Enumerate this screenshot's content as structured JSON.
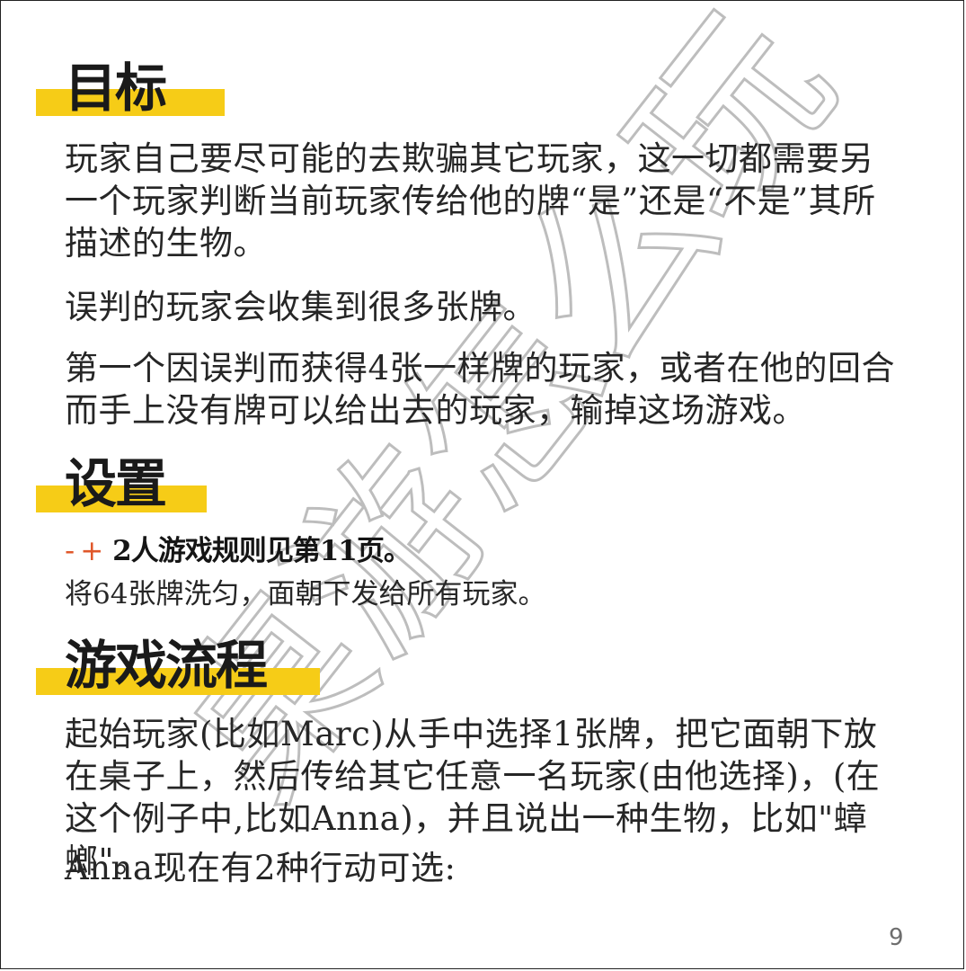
{
  "sections": {
    "goal": {
      "title": "目标",
      "paragraphs": [
        "玩家自己要尽可能的去欺骗其它玩家，这一切都需要另一个玩家判断当前玩家传给他的牌“是”还是“不是”其所描述的生物。",
        "误判的玩家会收集到很多张牌。",
        "第一个因误判而获得4张一样牌的玩家，或者在他的回合而手上没有牌可以给出去的玩家，输掉这场游戏。"
      ]
    },
    "setup": {
      "title": "设置",
      "dash": "-",
      "plus": "+",
      "rule_ref": "2人游戏规则见第11页。",
      "text": "将64张牌洗匀，面朝下发给所有玩家。"
    },
    "flow": {
      "title": "游戏流程",
      "paragraphs": [
        "起始玩家(比如Marc)从手中选择1张牌，把它面朝下放在桌子上，然后传给其它任意一名玩家(由他选择)，(在这个例子中,比如Anna)，并且说出一种生物，比如\"蟑螂\"。",
        "Anna现在有2种行动可选:"
      ]
    }
  },
  "watermark": "桌游怎么玩",
  "page_number": "9",
  "colors": {
    "highlight": "#f6cc17",
    "accent": "#e0572a",
    "text": "#262626"
  }
}
